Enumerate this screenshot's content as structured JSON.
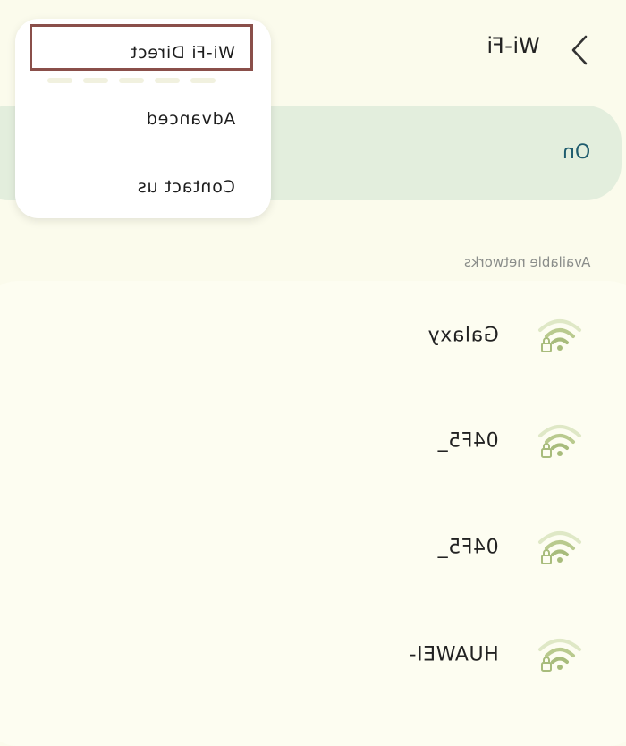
{
  "header": {
    "title": "Wi-Fi",
    "back_icon": "chevron-left-icon"
  },
  "toggle": {
    "state_label": "On",
    "accent_color": "#1f5c6e",
    "card_color": "#e3eedd"
  },
  "menu": {
    "items": [
      {
        "label": "Wi-Fi Direct",
        "highlighted": true
      },
      {
        "label": "Advanced",
        "highlighted": false
      },
      {
        "label": "Contact us",
        "highlighted": false
      }
    ],
    "highlight_color": "#8a4f4a"
  },
  "networks": {
    "section_label": "Available networks",
    "items": [
      {
        "ssid": "Galaxy",
        "icon": "wifi-lock-icon",
        "secured": true
      },
      {
        "ssid": "04F5_",
        "icon": "wifi-lock-icon",
        "secured": true
      },
      {
        "ssid": "04F5_",
        "icon": "wifi-lock-icon",
        "secured": true
      },
      {
        "ssid": "HUAWEI-",
        "icon": "wifi-lock-icon",
        "secured": true
      }
    ],
    "icon_color": "#a8bc7c"
  },
  "background_color": "#fbfbec"
}
